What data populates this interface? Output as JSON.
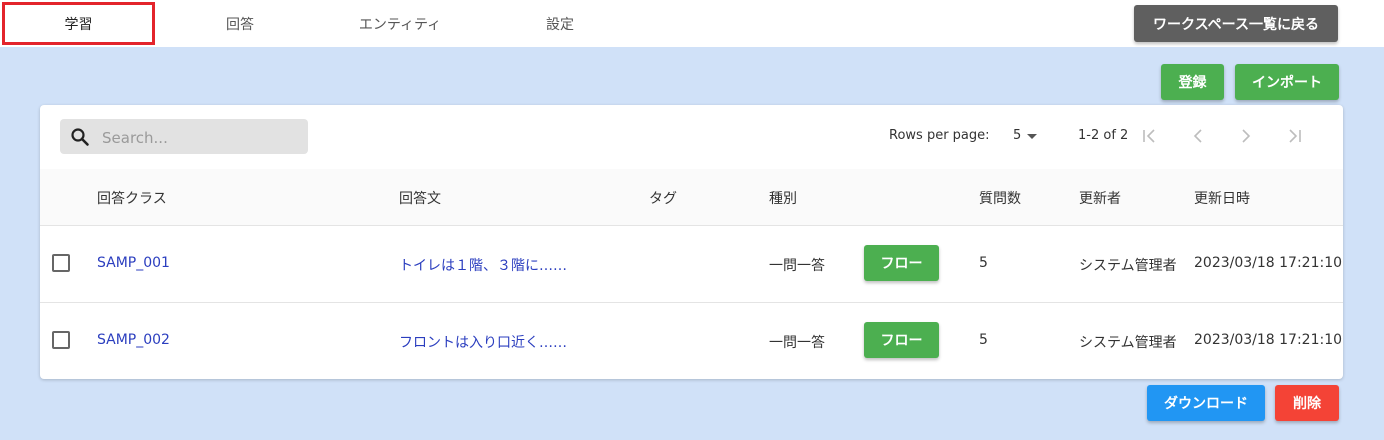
{
  "tabs": [
    {
      "label": "学習",
      "active": true
    },
    {
      "label": "回答"
    },
    {
      "label": "エンティティ"
    },
    {
      "label": "設定"
    }
  ],
  "header": {
    "back_label": "ワークスペース一覧に戻る"
  },
  "actions": {
    "register_label": "登録",
    "import_label": "インポート",
    "download_label": "ダウンロード",
    "delete_label": "削除"
  },
  "search": {
    "placeholder": "Search...",
    "value": ""
  },
  "pagination": {
    "rows_per_page_label": "Rows per page:",
    "rows_per_page": "5",
    "range": "1-2 of 2"
  },
  "table": {
    "headers": [
      "回答クラス",
      "回答文",
      "タグ",
      "種別",
      "質問数",
      "更新者",
      "更新日時"
    ],
    "rows": [
      {
        "answer_class": "SAMP_001",
        "answer_text": "トイレは１階、３階に……",
        "tag": "",
        "type": "一問一答",
        "flow_label": "フロー",
        "question_count": "5",
        "updater": "システム管理者",
        "updated_at": "2023/03/18 17:21:10"
      },
      {
        "answer_class": "SAMP_002",
        "answer_text": "フロントは入り口近く……",
        "tag": "",
        "type": "一問一答",
        "flow_label": "フロー",
        "question_count": "5",
        "updater": "システム管理者",
        "updated_at": "2023/03/18 17:21:10"
      }
    ]
  },
  "colors": {
    "background": "#d0e1f8",
    "active_tab_border": "#e3242b",
    "green": "#4caf50",
    "blue": "#2196f3",
    "red": "#f44336",
    "gray": "#5f5f5f",
    "link": "#2b3ebf"
  },
  "icons": {
    "search": "search-icon",
    "first_page": "first-page-icon",
    "prev_page": "chevron-left-icon",
    "next_page": "chevron-right-icon",
    "last_page": "last-page-icon",
    "dropdown": "caret-down-icon"
  }
}
